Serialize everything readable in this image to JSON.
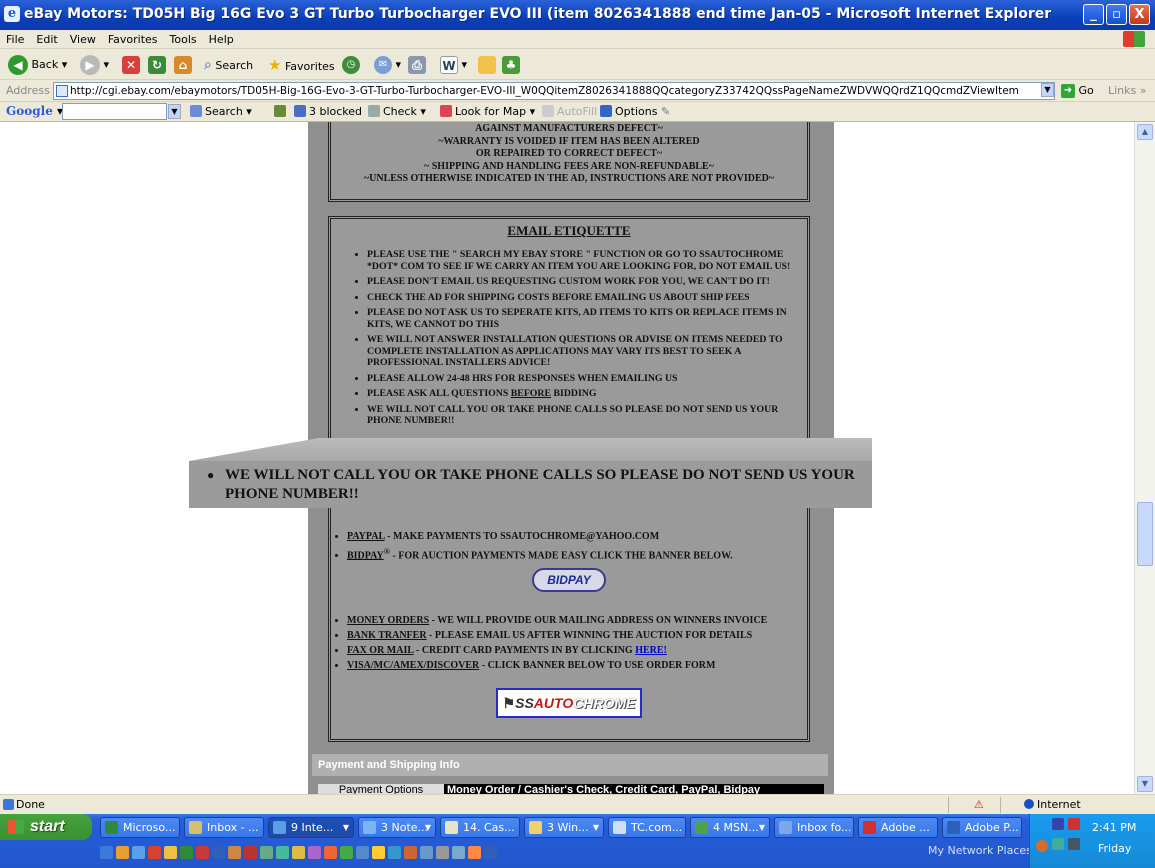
{
  "window": {
    "title": "eBay Motors: TD05H Big 16G Evo 3 GT Turbo Turbocharger EVO III (item 8026341888 end time Jan-05 - Microsoft Internet Explorer",
    "minimize": "_",
    "maximize": "▫",
    "close": "X"
  },
  "menu": [
    "File",
    "Edit",
    "View",
    "Favorites",
    "Tools",
    "Help"
  ],
  "toolbar": {
    "back": "Back",
    "search": "Search",
    "favorites": "Favorites"
  },
  "address": {
    "label": "Address",
    "url": "http://cgi.ebay.com/ebaymotors/TD05H-Big-16G-Evo-3-GT-Turbo-Turbocharger-EVO-III_W0QQitemZ8026341888QQcategoryZ33742QQssPageNameZWDVWQQrdZ1QQcmdZViewItem",
    "go": "Go",
    "links": "Links"
  },
  "googlebar": {
    "logo": "Google",
    "search": "Search",
    "blocked": "3 blocked",
    "check": "Check",
    "lookformap": "Look for Map",
    "autofill": "AutoFill",
    "options": "Options"
  },
  "terms": {
    "lines": [
      "AGAINST MANUFACTURERS DEFECT~",
      "~WARRANTY IS VOIDED IF ITEM HAS BEEN ALTERED",
      "OR REPAIRED TO CORRECT DEFECT~",
      "~ SHIPPING AND HANDLING FEES ARE NON-REFUNDABLE~",
      "~UNLESS OTHERWISE INDICATED IN THE AD, INSTRUCTIONS ARE NOT PROVIDED~"
    ]
  },
  "email": {
    "heading": "EMAIL ETIQUETTE",
    "items": [
      "PLEASE USE THE \" SEARCH MY EBAY STORE \" FUNCTION OR GO TO SSAUTOCHROME *DOT* COM TO SEE IF WE CARRY AN ITEM YOU ARE LOOKING FOR, DO NOT EMAIL US!",
      "PLEASE DON'T EMAIL US REQUESTING CUSTOM WORK FOR YOU, WE CAN'T DO IT!",
      "CHECK THE AD FOR SHIPPING COSTS BEFORE EMAILING US ABOUT SHIP FEES",
      "PLEASE DO NOT ASK US TO SEPERATE KITS, AD ITEMS TO KITS OR REPLACE ITEMS IN KITS, WE CANNOT DO THIS",
      "WE WILL NOT ANSWER INSTALLATION QUESTIONS OR ADVISE ON ITEMS NEEDED TO COMPLETE INSTALLATION AS APPLICATIONS MAY VARY ITS BEST TO SEEK A PROFESSIONAL INSTALLERS ADVICE!",
      "PLEASE ALLOW 24-48 HRS FOR RESPONSES WHEN EMAILING US"
    ],
    "ask_prefix": "PLEASE ASK ALL QUESTIONS ",
    "ask_before": "BEFORE",
    "ask_suffix": " BIDDING",
    "last_item": "WE WILL NOT CALL YOU OR TAKE PHONE CALLS SO PLEASE DO NOT SEND US YOUR PHONE NUMBER!!"
  },
  "magnifier": {
    "text": "WE WILL NOT CALL YOU OR TAKE PHONE CALLS SO PLEASE DO NOT SEND US YOUR PHONE NUMBER!!"
  },
  "payment": {
    "paypal_k": "PAYPAL",
    "paypal_v": " - MAKE PAYMENTS TO SSAUTOCHROME@YAHOO.COM",
    "bidpay_k": "BIDPAY",
    "bidpay_sup": "®",
    "bidpay_v": " - FOR AUCTION PAYMENTS MADE EASY CLICK THE BANNER BELOW.",
    "bidpay_banner": "BIDPAY",
    "money_k": "MONEY ORDERS",
    "money_v": " - WE WILL PROVIDE OUR MAILING ADDRESS ON WINNERS INVOICE",
    "bank_k": "BANK TRANFER",
    "bank_v": " - PLEASE EMAIL US AFTER WINNING THE AUCTION FOR DETAILS",
    "fax_k": "FAX OR MAIL",
    "fax_v": " - CREDIT CARD PAYMENTS IN BY CLICKING ",
    "fax_link": "HERE!",
    "visa_k": "VISA/MC/AMEX/DISCOVER",
    "visa_v": " - CLICK BANNER BELOW TO USE ORDER FORM",
    "banner_ss": "SS",
    "banner_auto": "AUTO",
    "banner_chrome": "CHROME"
  },
  "shipinfo": {
    "heading": "Payment and Shipping Info",
    "options_label": "Payment Options",
    "options_value": "Money Order / Cashier's Check, Credit Card, PayPal, Bidpay"
  },
  "status": {
    "text": "Done",
    "zone": "Internet"
  },
  "taskbar": {
    "start": "start",
    "tasks": [
      "Microso...",
      "Inbox - ...",
      "9 Inte...",
      "3 Note...",
      "14. Cas...",
      "3 Win...",
      "TC.com...",
      "4 MSN...",
      "Inbox fo...",
      "Adobe ...",
      "Adobe P..."
    ],
    "mynetwork": "My Network Places",
    "clock": "2:41 PM",
    "day": "Friday"
  },
  "colors": {
    "page_bg": "#8f8f8f",
    "panel_bg": "#9a9a9a",
    "titlebar": "#0a3fb8",
    "taskbar": "#245edb",
    "start": "#3a9133"
  }
}
